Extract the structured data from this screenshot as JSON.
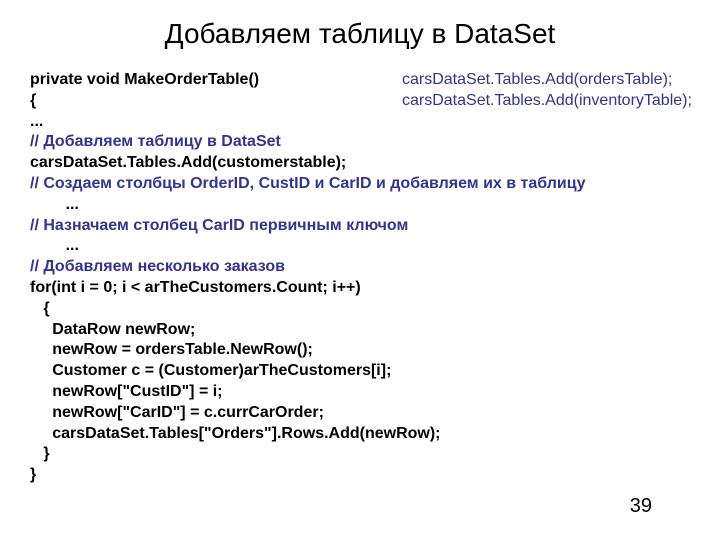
{
  "title": "Добавляем таблицу в DataSet",
  "code": {
    "l1": "private void MakeOrderTable()",
    "l2": "{",
    "l3": "...",
    "c1": "// Добавляем таблицу в DataSet",
    "l4": "carsDataSet.Tables.Add(customerstable);",
    "blank1": "",
    "c2": "// Создаем столбцы OrderID, CustID и CarID и добавляем их в таблицу",
    "l5": "        ...",
    "c3": "// Назначаем столбец CarID первичным ключом",
    "l6": "        ...",
    "c4": "// Добавляем несколько заказов",
    "l7": "for(int i = 0; i < arTheCustomers.Count; i++)",
    "l8": "   {",
    "l9": "     DataRow newRow;",
    "l10": "     newRow = ordersTable.NewRow();",
    "l11": "     Customer c = (Customer)arTheCustomers[i];",
    "l12": "     newRow[\"CustID\"] = i;",
    "l13": "     newRow[\"CarID\"] = c.currCarOrder;",
    "l14": "     carsDataSet.Tables[\"Orders\"].Rows.Add(newRow);",
    "l15": "   }",
    "l16": "}"
  },
  "side": {
    "s1": "carsDataSet.Tables.Add(ordersTable);",
    "s2": "carsDataSet.Tables.Add(inventoryTable);"
  },
  "pagenum": "39"
}
